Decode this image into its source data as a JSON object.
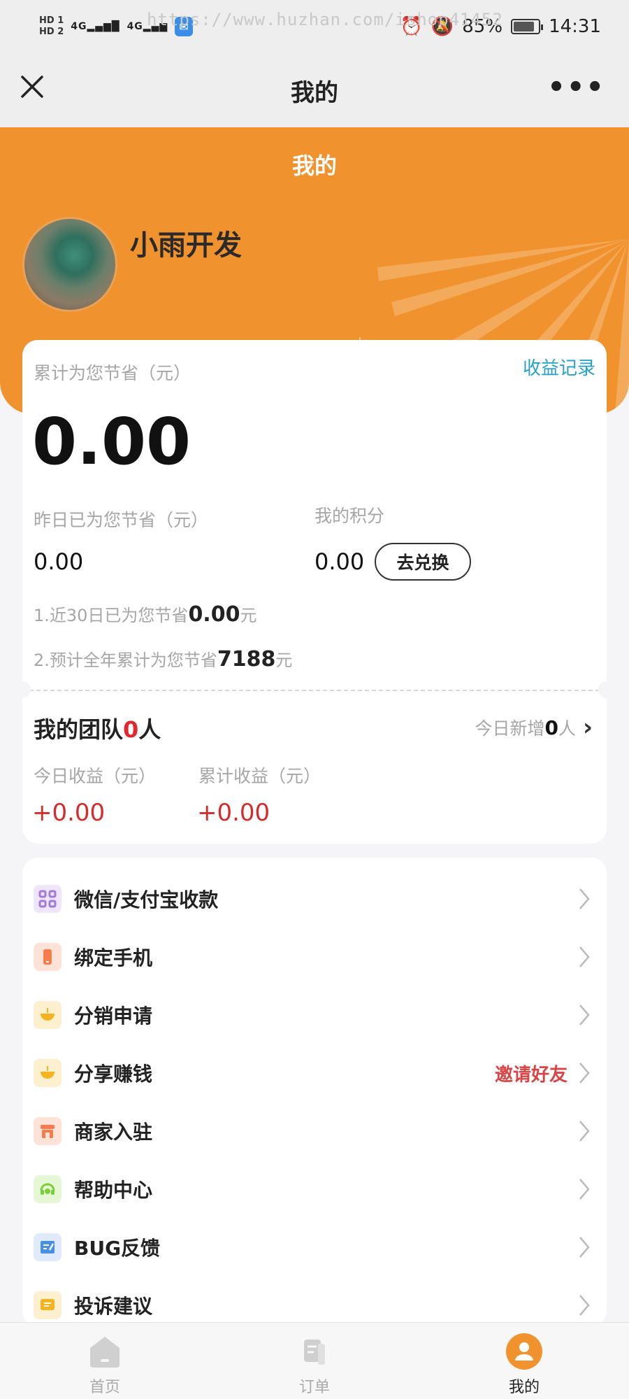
{
  "status_bar": {
    "hd1": "HD 1",
    "hd2": "HD 2",
    "signal1": "4G",
    "signal2": "4G",
    "url_watermark": "https://www.huzhan.com/ishop41452",
    "battery": "85%",
    "time": "14:31"
  },
  "header": {
    "title": "我的"
  },
  "banner": {
    "title": "我的",
    "username": "小雨开发"
  },
  "savings": {
    "total_label": "累计为您节省（元）",
    "records_link": "收益记录",
    "total_value": "0.00",
    "yesterday_label": "昨日已为您节省（元）",
    "yesterday_value": "0.00",
    "points_label": "我的积分",
    "points_value": "0.00",
    "exchange_button": "去兑换",
    "note1_prefix": "1.近30日已为您节省",
    "note1_value": "0.00",
    "note1_suffix": "元",
    "note2_prefix": "2.预计全年累计为您节省",
    "note2_value": "7188",
    "note2_suffix": "元"
  },
  "team": {
    "title_prefix": "我的团队",
    "count": "0",
    "title_suffix": "人",
    "new_today_prefix": "今日新增",
    "new_today_count": "0",
    "new_today_suffix": "人",
    "today_income_label": "今日收益（元）",
    "today_income_value": "+0.00",
    "total_income_label": "累计收益（元）",
    "total_income_value": "+0.00"
  },
  "menu": [
    {
      "label": "微信/支付宝收款",
      "icon": "qr-code-icon",
      "color": "#c9a8f0"
    },
    {
      "label": "绑定手机",
      "icon": "phone-icon",
      "color": "#f47c4d"
    },
    {
      "label": "分销申请",
      "icon": "bowl-icon",
      "color": "#f5b320"
    },
    {
      "label": "分享赚钱",
      "icon": "bowl-icon",
      "color": "#f5b320",
      "extra": "邀请好友"
    },
    {
      "label": "商家入驻",
      "icon": "shop-icon",
      "color": "#f47c4d"
    },
    {
      "label": "帮助中心",
      "icon": "headset-icon",
      "color": "#7ccf3a"
    },
    {
      "label": "BUG反馈",
      "icon": "edit-icon",
      "color": "#4a90e2"
    },
    {
      "label": "投诉建议",
      "icon": "message-icon",
      "color": "#f5b320"
    }
  ],
  "tabbar": {
    "home": "首页",
    "orders": "订单",
    "mine": "我的"
  },
  "colors": {
    "brand_orange": "#f0922e",
    "link_blue": "#27a0c9",
    "profit_red": "#d42b2b"
  }
}
